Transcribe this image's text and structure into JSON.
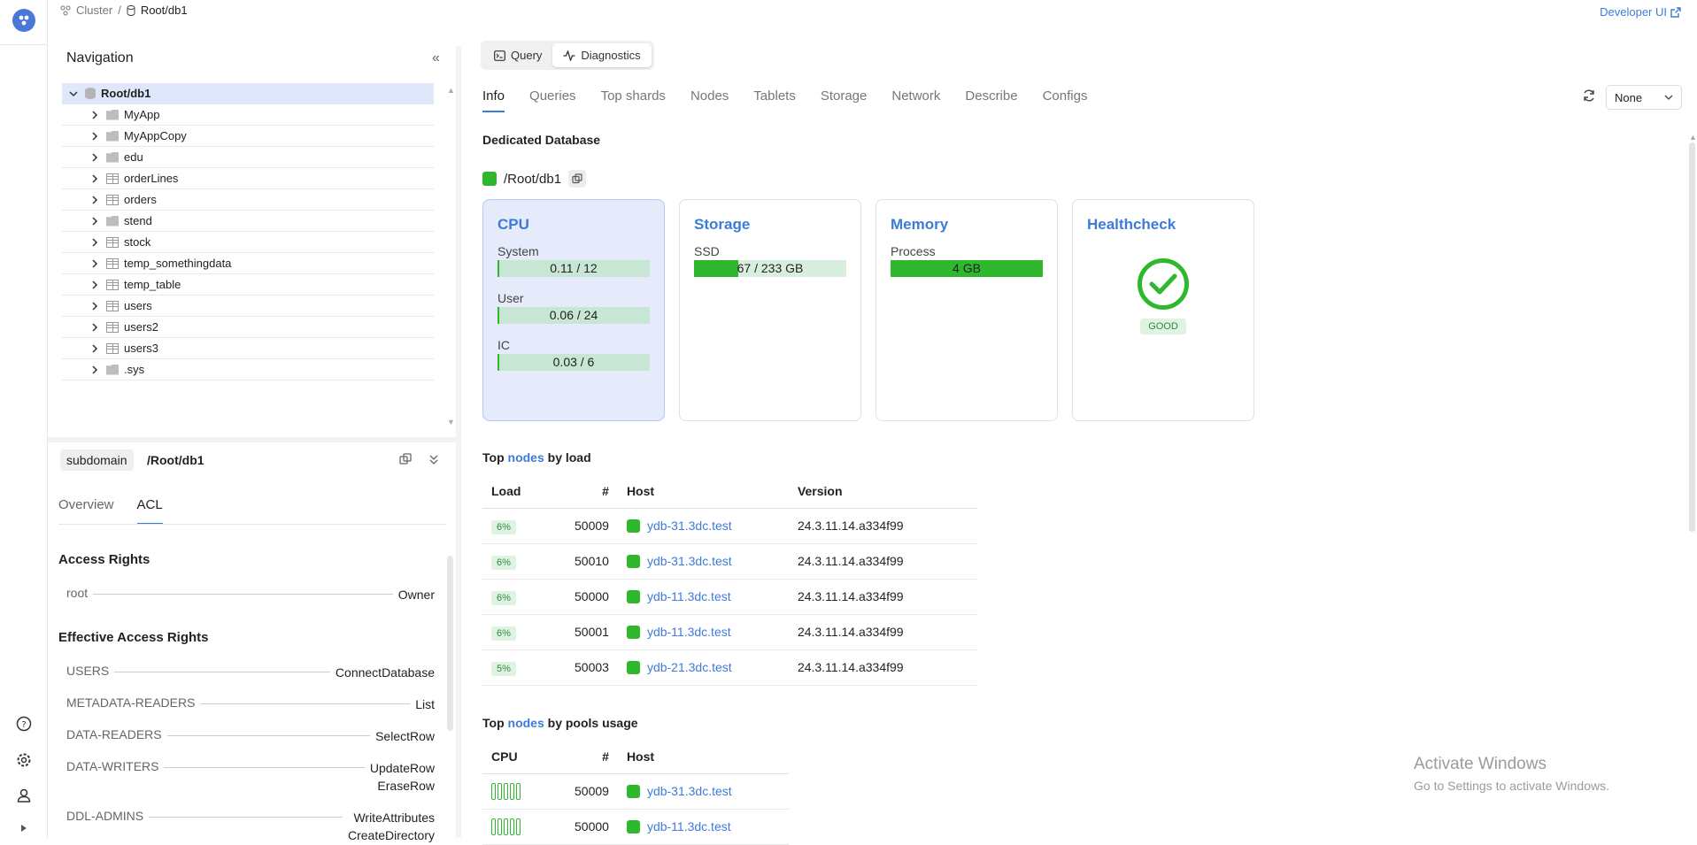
{
  "breadcrumb": {
    "cluster": "Cluster",
    "separator": "/",
    "current": "Root/db1"
  },
  "developer_ui": "Developer UI",
  "navigation": {
    "title": "Navigation",
    "root": "Root/db1",
    "items": [
      {
        "label": "MyApp",
        "type": "folder"
      },
      {
        "label": "MyAppCopy",
        "type": "folder"
      },
      {
        "label": "edu",
        "type": "folder"
      },
      {
        "label": "orderLines",
        "type": "table"
      },
      {
        "label": "orders",
        "type": "table"
      },
      {
        "label": "stend",
        "type": "folder"
      },
      {
        "label": "stock",
        "type": "table"
      },
      {
        "label": "temp_somethingdata",
        "type": "table"
      },
      {
        "label": "temp_table",
        "type": "table"
      },
      {
        "label": "users",
        "type": "table"
      },
      {
        "label": "users2",
        "type": "table"
      },
      {
        "label": "users3",
        "type": "table"
      },
      {
        "label": ".sys",
        "type": "folder"
      }
    ]
  },
  "subdomain": {
    "tag": "subdomain",
    "path": "/Root/db1",
    "tabs": [
      "Overview",
      "ACL"
    ],
    "active_tab": "ACL",
    "access_rights_title": "Access Rights",
    "access_rights": [
      {
        "subject": "root",
        "rights": "Owner"
      }
    ],
    "effective_title": "Effective Access Rights",
    "effective": [
      {
        "subject": "USERS",
        "rights": [
          "ConnectDatabase"
        ]
      },
      {
        "subject": "METADATA-READERS",
        "rights": [
          "List"
        ]
      },
      {
        "subject": "DATA-READERS",
        "rights": [
          "SelectRow"
        ]
      },
      {
        "subject": "DATA-WRITERS",
        "rights": [
          "UpdateRow",
          "EraseRow"
        ]
      },
      {
        "subject": "DDL-ADMINS",
        "rights": [
          "WriteAttributes",
          "CreateDirectory"
        ]
      }
    ]
  },
  "modes": {
    "query": "Query",
    "diagnostics": "Diagnostics",
    "active": "Diagnostics"
  },
  "tabs": [
    "Info",
    "Queries",
    "Top shards",
    "Nodes",
    "Tablets",
    "Storage",
    "Network",
    "Describe",
    "Configs"
  ],
  "active_tab": "Info",
  "autorefresh": "None",
  "db_type": "Dedicated Database",
  "db_path": "/Root/db1",
  "status_color": "#2eb82e",
  "cards": {
    "cpu": {
      "title": "CPU",
      "metrics": [
        {
          "label": "System",
          "text": "0.11 / 12",
          "fraction": 0.01
        },
        {
          "label": "User",
          "text": "0.06 / 24",
          "fraction": 0.003
        },
        {
          "label": "IC",
          "text": "0.03 / 6",
          "fraction": 0.005
        }
      ]
    },
    "storage": {
      "title": "Storage",
      "metrics": [
        {
          "label": "SSD",
          "text": "67 / 233 GB",
          "fraction": 0.29
        }
      ]
    },
    "memory": {
      "title": "Memory",
      "metrics": [
        {
          "label": "Process",
          "text": "4 GB",
          "fraction": 1.0
        }
      ]
    },
    "healthcheck": {
      "title": "Healthcheck",
      "status": "GOOD"
    }
  },
  "top_load": {
    "title_pre": "Top",
    "title_link": "nodes",
    "title_post": "by load",
    "headers": [
      "Load",
      "#",
      "Host",
      "Version"
    ],
    "rows": [
      {
        "load": "6%",
        "id": "50009",
        "host": "ydb-31.3dc.test",
        "version": "24.3.11.14.a334f99"
      },
      {
        "load": "6%",
        "id": "50010",
        "host": "ydb-31.3dc.test",
        "version": "24.3.11.14.a334f99"
      },
      {
        "load": "6%",
        "id": "50000",
        "host": "ydb-11.3dc.test",
        "version": "24.3.11.14.a334f99"
      },
      {
        "load": "6%",
        "id": "50001",
        "host": "ydb-11.3dc.test",
        "version": "24.3.11.14.a334f99"
      },
      {
        "load": "5%",
        "id": "50003",
        "host": "ydb-21.3dc.test",
        "version": "24.3.11.14.a334f99"
      }
    ]
  },
  "top_pools": {
    "title_pre": "Top",
    "title_link": "nodes",
    "title_post": "by pools usage",
    "headers": [
      "CPU",
      "#",
      "Host"
    ],
    "rows": [
      {
        "id": "50009",
        "host": "ydb-31.3dc.test"
      },
      {
        "id": "50000",
        "host": "ydb-11.3dc.test"
      }
    ]
  },
  "watermark": {
    "line1": "Activate Windows",
    "line2": "Go to Settings to activate Windows."
  }
}
